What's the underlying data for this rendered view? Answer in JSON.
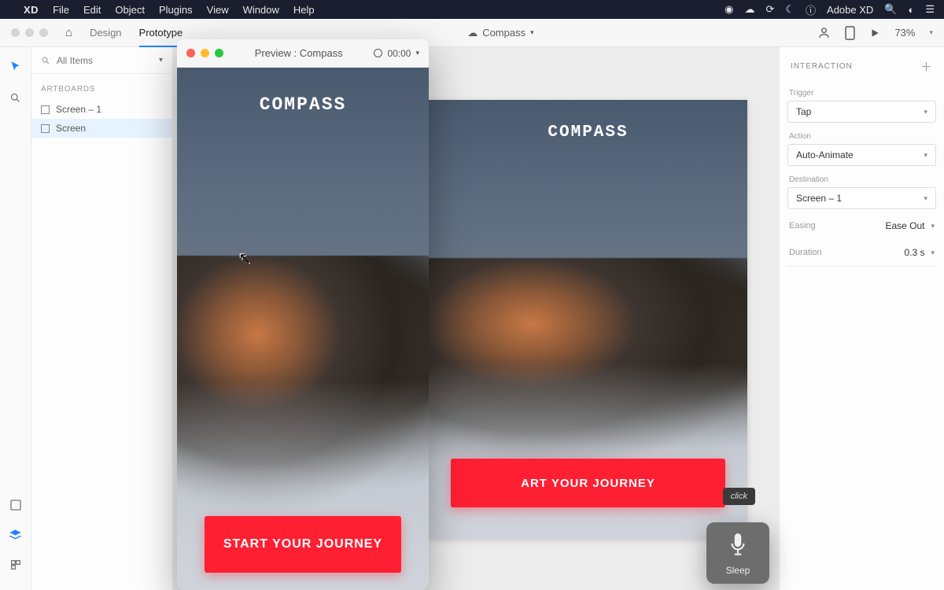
{
  "menubar": {
    "app": "XD",
    "items": [
      "File",
      "Edit",
      "Object",
      "Plugins",
      "View",
      "Window",
      "Help"
    ],
    "right_app": "Adobe XD"
  },
  "toolbar": {
    "tabs": {
      "design": "Design",
      "prototype": "Prototype"
    },
    "doc_title": "Compass",
    "zoom": "73%"
  },
  "left_panel": {
    "search_label": "All Items",
    "section": "ARTBOARDS",
    "items": [
      "Screen – 1",
      "Screen"
    ]
  },
  "artboard": {
    "title": "COMPASS",
    "cta": "ART YOUR JOURNEY"
  },
  "preview": {
    "window_title": "Preview : Compass",
    "timer": "00:00",
    "title": "COMPASS",
    "cta": "START YOUR JOURNEY"
  },
  "inspector": {
    "title": "INTERACTION",
    "trigger_label": "Trigger",
    "trigger_value": "Tap",
    "action_label": "Action",
    "action_value": "Auto-Animate",
    "destination_label": "Destination",
    "destination_value": "Screen – 1",
    "easing_label": "Easing",
    "easing_value": "Ease Out",
    "duration_label": "Duration",
    "duration_value": "0.3 s"
  },
  "voice": {
    "tooltip": "click",
    "label": "Sleep"
  }
}
